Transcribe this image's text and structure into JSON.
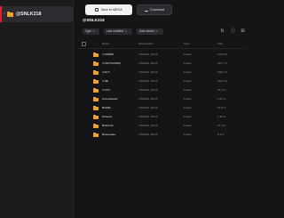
{
  "sidebar": {
    "items": [
      {
        "label": "@SNLK218",
        "icon": "folder-icon",
        "selected": true
      }
    ]
  },
  "toolbar": {
    "save_label": "Save to MEGA",
    "download_label": "Download"
  },
  "breadcrumb": {
    "label": "@SNLK218"
  },
  "filters": {
    "type": "Type",
    "last_modified": "Last modified",
    "date_added": "Date added"
  },
  "table": {
    "headers": {
      "name": "Name",
      "date_added": "Date added",
      "type": "Type",
      "size": "Size"
    },
    "rows": [
      {
        "name": "4 ОКВЭЛ",
        "date": "7/3/2022, 20:23",
        "type": "Folder",
        "size": "136.8 G"
      },
      {
        "name": "4 (NOTCOINS)",
        "date": "7/3/2022, 20:23",
        "type": "Folder",
        "size": "427.7 G"
      },
      {
        "name": "4 ALT!",
        "date": "7/3/2022, 20:23",
        "type": "Folder",
        "size": "136.1 G"
      },
      {
        "name": "4 ЛЕ",
        "date": "7/3/2022, 20:23",
        "type": "Folder",
        "size": "183.2 G"
      },
      {
        "name": "4 СТО",
        "date": "7/3/2022, 20:23",
        "type": "Folder",
        "size": "64.4 G"
      },
      {
        "name": "Ассоциации",
        "date": "7/3/2022, 20:23",
        "type": "Folder",
        "size": "2.01 G"
      },
      {
        "name": "Всё/Во",
        "date": "7/3/2022, 20:23",
        "type": "Folder",
        "size": "87.6 G"
      },
      {
        "name": "Screens",
        "date": "7/3/2022, 20:23",
        "type": "Folder",
        "size": "1.26 G"
      },
      {
        "name": "Всё/Стас",
        "date": "7/3/2022, 20:23",
        "type": "Folder",
        "size": "27.4 G"
      },
      {
        "name": "Военщина",
        "date": "7/3/2022, 20:23",
        "type": "Folder",
        "size": "8.1 G"
      }
    ]
  },
  "colors": {
    "accent": "#e5202e",
    "folder": "#f0a22a",
    "background": "#151518",
    "sidebar": "#1b1b1e"
  }
}
